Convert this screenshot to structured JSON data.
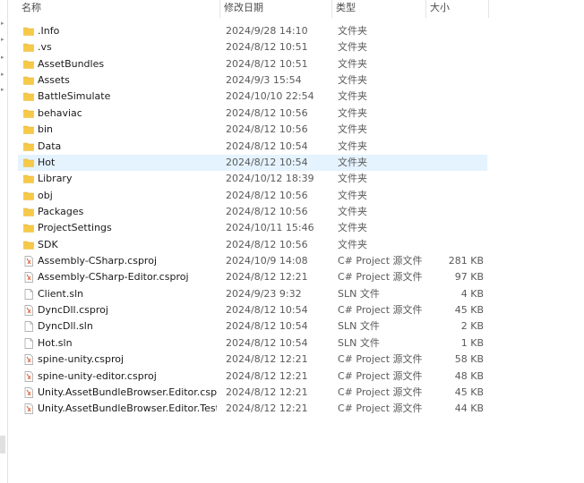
{
  "columns": {
    "name": "名称",
    "date": "修改日期",
    "type": "类型",
    "size": "大小"
  },
  "files": [
    {
      "name": ".Info",
      "date": "2024/9/28 14:10",
      "type": "文件夹",
      "size": "",
      "icon": "folder-icon"
    },
    {
      "name": ".vs",
      "date": "2024/8/12 10:51",
      "type": "文件夹",
      "size": "",
      "icon": "folder-icon"
    },
    {
      "name": "AssetBundles",
      "date": "2024/8/12 10:51",
      "type": "文件夹",
      "size": "",
      "icon": "folder-icon"
    },
    {
      "name": "Assets",
      "date": "2024/9/3 15:54",
      "type": "文件夹",
      "size": "",
      "icon": "folder-icon"
    },
    {
      "name": "BattleSimulate",
      "date": "2024/10/10 22:54",
      "type": "文件夹",
      "size": "",
      "icon": "folder-icon"
    },
    {
      "name": "behaviac",
      "date": "2024/8/12 10:56",
      "type": "文件夹",
      "size": "",
      "icon": "folder-icon"
    },
    {
      "name": "bin",
      "date": "2024/8/12 10:56",
      "type": "文件夹",
      "size": "",
      "icon": "folder-icon"
    },
    {
      "name": "Data",
      "date": "2024/8/12 10:54",
      "type": "文件夹",
      "size": "",
      "icon": "folder-icon"
    },
    {
      "name": "Hot",
      "date": "2024/8/12 10:54",
      "type": "文件夹",
      "size": "",
      "icon": "folder-icon",
      "hover": true
    },
    {
      "name": "Library",
      "date": "2024/10/12 18:39",
      "type": "文件夹",
      "size": "",
      "icon": "folder-icon"
    },
    {
      "name": "obj",
      "date": "2024/8/12 10:56",
      "type": "文件夹",
      "size": "",
      "icon": "folder-icon"
    },
    {
      "name": "Packages",
      "date": "2024/8/12 10:56",
      "type": "文件夹",
      "size": "",
      "icon": "folder-icon"
    },
    {
      "name": "ProjectSettings",
      "date": "2024/10/11 15:46",
      "type": "文件夹",
      "size": "",
      "icon": "folder-icon"
    },
    {
      "name": "SDK",
      "date": "2024/8/12 10:56",
      "type": "文件夹",
      "size": "",
      "icon": "folder-icon"
    },
    {
      "name": "Assembly-CSharp.csproj",
      "date": "2024/10/9 14:08",
      "type": "C# Project 源文件",
      "size": "281 KB",
      "icon": "csproj-file-icon"
    },
    {
      "name": "Assembly-CSharp-Editor.csproj",
      "date": "2024/8/12 12:21",
      "type": "C# Project 源文件",
      "size": "97 KB",
      "icon": "csproj-file-icon"
    },
    {
      "name": "Client.sln",
      "date": "2024/9/23 9:32",
      "type": "SLN 文件",
      "size": "4 KB",
      "icon": "sln-file-icon"
    },
    {
      "name": "DyncDll.csproj",
      "date": "2024/8/12 10:54",
      "type": "C# Project 源文件",
      "size": "45 KB",
      "icon": "csproj-file-icon"
    },
    {
      "name": "DyncDll.sln",
      "date": "2024/8/12 10:54",
      "type": "SLN 文件",
      "size": "2 KB",
      "icon": "sln-file-icon"
    },
    {
      "name": "Hot.sln",
      "date": "2024/8/12 10:54",
      "type": "SLN 文件",
      "size": "1 KB",
      "icon": "sln-file-icon"
    },
    {
      "name": "spine-unity.csproj",
      "date": "2024/8/12 12:21",
      "type": "C# Project 源文件",
      "size": "58 KB",
      "icon": "csproj-file-icon"
    },
    {
      "name": "spine-unity-editor.csproj",
      "date": "2024/8/12 12:21",
      "type": "C# Project 源文件",
      "size": "48 KB",
      "icon": "csproj-file-icon"
    },
    {
      "name": "Unity.AssetBundleBrowser.Editor.cspr...",
      "date": "2024/8/12 12:21",
      "type": "C# Project 源文件",
      "size": "45 KB",
      "icon": "csproj-file-icon"
    },
    {
      "name": "Unity.AssetBundleBrowser.Editor.Test...",
      "date": "2024/8/12 12:21",
      "type": "C# Project 源文件",
      "size": "44 KB",
      "icon": "csproj-file-icon"
    }
  ],
  "colors": {
    "folder": "#f7c948",
    "hover": "#e5f3ff",
    "csproj_accent": "#d9542b"
  }
}
